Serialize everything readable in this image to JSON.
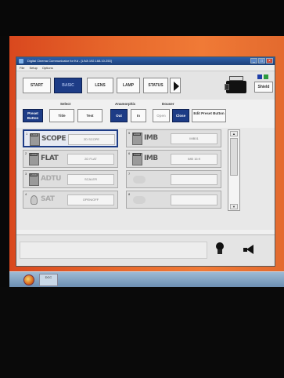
{
  "window": {
    "title": "Digital Cinema Communicator for Kd - [LIVA 192.168.10.253]",
    "menu": [
      "File",
      "Setup",
      "Options"
    ]
  },
  "nav": {
    "buttons": [
      "START",
      "BASIC",
      "LENS",
      "LAMP",
      "STATUS"
    ],
    "active": "BASIC"
  },
  "shield_label": "Shield",
  "controls": {
    "preset_button": "Preset Button",
    "select_group": "Select",
    "title": "Title",
    "test": "Test",
    "anamorphic_group": "Anamorphic",
    "out": "Out",
    "in": "In",
    "douser_group": "Douser",
    "open": "Open",
    "close": "Close",
    "edit_preset": "Edit Preset Button"
  },
  "presets": [
    {
      "num": "1",
      "tag": "LOCK",
      "big": "SCOPE",
      "label": "2D SCOPE",
      "selected": true
    },
    {
      "num": "2",
      "tag": "LOCK",
      "big": "FLAT",
      "label": "2D FLAT",
      "selected": false
    },
    {
      "num": "3",
      "tag": "LOCK",
      "big": "ADTU",
      "label": "SCALER",
      "selected": false
    },
    {
      "num": "4",
      "tag": "",
      "big": "SAT",
      "label": "OPEN/OFF",
      "selected": false
    },
    {
      "num": "5",
      "tag": "LOCK",
      "big": "IMB",
      "label": "IMB01",
      "selected": false
    },
    {
      "num": "6",
      "tag": "LOCK",
      "big": "IMB",
      "label": "IMB 16:9",
      "selected": false
    },
    {
      "num": "7",
      "tag": "",
      "big": "",
      "label": "",
      "selected": false
    },
    {
      "num": "8",
      "tag": "",
      "big": "",
      "label": "",
      "selected": false
    }
  ],
  "scroll": {
    "up": "▲",
    "down": "▼"
  },
  "taskbar": {
    "item": "DCC"
  },
  "icons": {
    "projector": "projector-icon",
    "lamp": "lamp-icon",
    "speaker": "speaker-icon",
    "start": "windows-start-icon"
  },
  "colors": {
    "active_blue": "#1d3c86",
    "desktop_orange": "#e8692c"
  }
}
